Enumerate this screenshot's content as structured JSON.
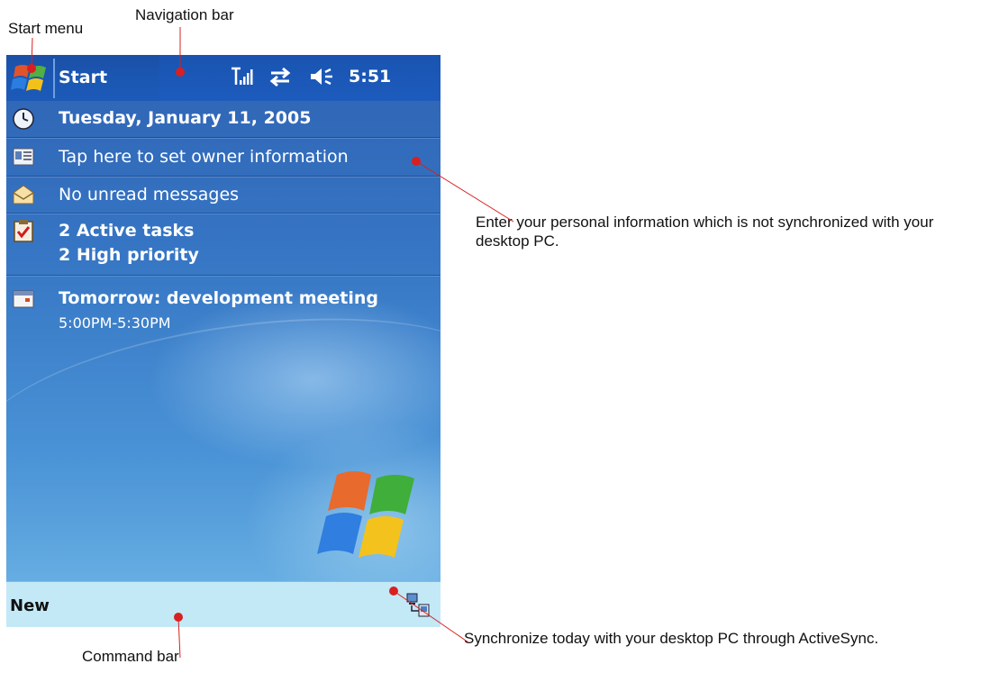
{
  "annotations": {
    "start_menu": "Start menu",
    "navigation_bar": "Navigation bar",
    "owner_info": "Enter your personal information which is not synchronized with your desktop PC.",
    "command_bar": "Command bar",
    "sync": "Synchronize today with your desktop PC through ActiveSync."
  },
  "navbar": {
    "start_label": "Start",
    "time": "5:51",
    "status_icons": [
      "signal-strength-icon",
      "connectivity-icon",
      "volume-icon"
    ]
  },
  "today": {
    "date": "Tuesday, January 11, 2005",
    "owner": "Tap here to set owner information",
    "messages": "No unread messages",
    "tasks_line1": "2 Active tasks",
    "tasks_line2": "2 High priority",
    "calendar_title": "Tomorrow: development meeting",
    "calendar_time": "5:00PM-5:30PM"
  },
  "command_bar": {
    "new_label": "New",
    "sync_icon": "activesync-icon"
  },
  "colors": {
    "navbar": "#1a57b3",
    "today_bg": "#3676c4",
    "command_bar": "#c3e9f7",
    "callout_line": "#d82020"
  }
}
